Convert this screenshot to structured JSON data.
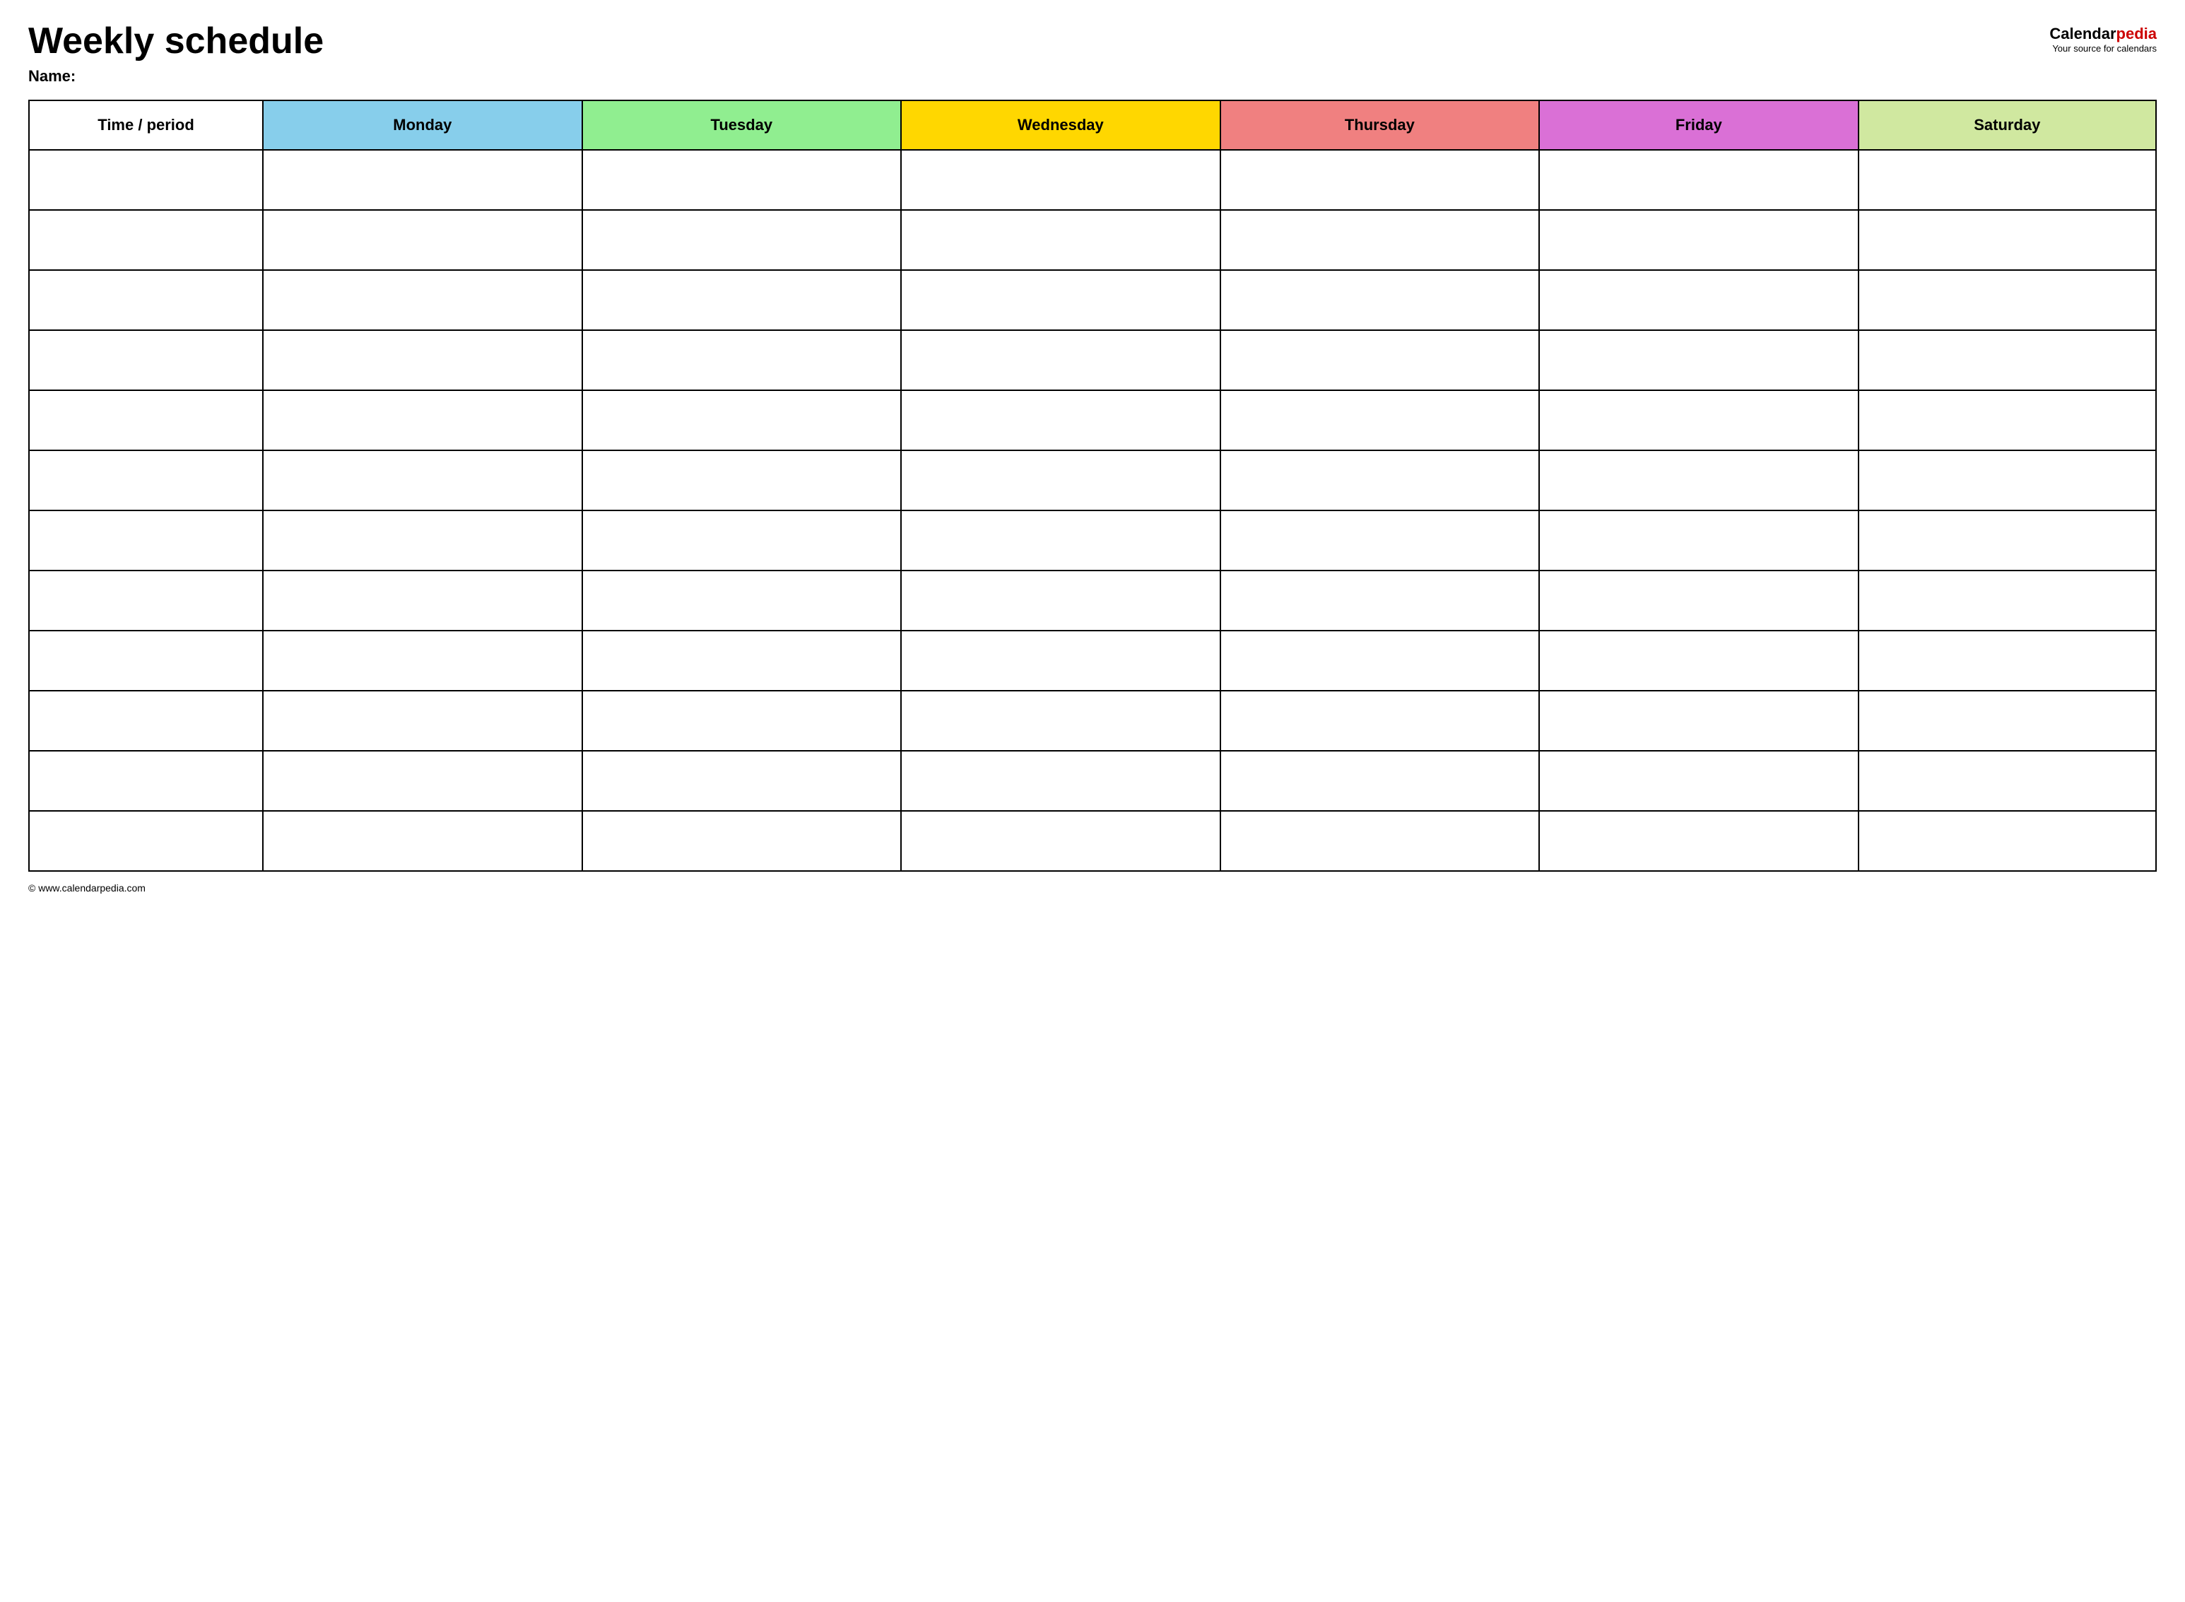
{
  "header": {
    "title": "Weekly schedule",
    "name_label": "Name:",
    "logo": {
      "calendar_text": "Calendar",
      "pedia_text": "pedia",
      "tagline": "Your source for calendars"
    }
  },
  "table": {
    "columns": [
      {
        "key": "time",
        "label": "Time / period",
        "class": "th-time"
      },
      {
        "key": "monday",
        "label": "Monday",
        "class": "th-monday"
      },
      {
        "key": "tuesday",
        "label": "Tuesday",
        "class": "th-tuesday"
      },
      {
        "key": "wednesday",
        "label": "Wednesday",
        "class": "th-wednesday"
      },
      {
        "key": "thursday",
        "label": "Thursday",
        "class": "th-thursday"
      },
      {
        "key": "friday",
        "label": "Friday",
        "class": "th-friday"
      },
      {
        "key": "saturday",
        "label": "Saturday",
        "class": "th-saturday"
      }
    ],
    "row_count": 12
  },
  "footer": {
    "url": "© www.calendarpedia.com"
  }
}
